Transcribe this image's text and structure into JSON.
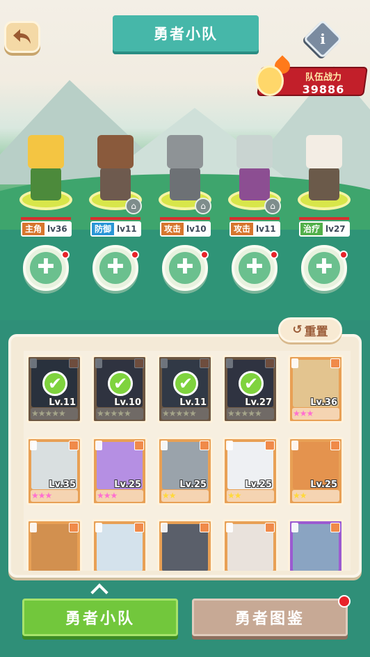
{
  "header": {
    "title": "勇者小队",
    "back_icon": "back-arrow-icon",
    "info_icon": "info-icon",
    "info_glyph": "i"
  },
  "power": {
    "label": "队伍战力",
    "value": "39886",
    "icon": "trophy-fist-icon"
  },
  "party": [
    {
      "role": "主角",
      "level": "lv36",
      "role_color": "#d7762e",
      "locked": false,
      "head_color": "#f4c542",
      "body_color": "#4c8a3b"
    },
    {
      "role": "防御",
      "level": "lv11",
      "role_color": "#2a96d6",
      "locked": true,
      "head_color": "#8a5a3c",
      "body_color": "#6e5a4e"
    },
    {
      "role": "攻击",
      "level": "lv10",
      "role_color": "#d7762e",
      "locked": true,
      "head_color": "#8e9396",
      "body_color": "#6d7175"
    },
    {
      "role": "攻击",
      "level": "lv11",
      "role_color": "#d7762e",
      "locked": true,
      "head_color": "#c9d4d1",
      "body_color": "#8c4e92"
    },
    {
      "role": "治疗",
      "level": "lv27",
      "role_color": "#52b04a",
      "locked": false,
      "head_color": "#f3ede4",
      "body_color": "#6b5a4a"
    }
  ],
  "add_slot_glyph": "✚",
  "lock_glyph": "🔒",
  "reset_label": "重置",
  "reset_icon": "↺",
  "check_glyph": "✔",
  "roster": [
    {
      "level": "Lv.11",
      "stars": "★★★★★",
      "star_color": "grey",
      "in_team": true,
      "frame": "orange",
      "art": "#3b3f48"
    },
    {
      "level": "Lv.10",
      "stars": "★★★★★",
      "star_color": "grey",
      "in_team": true,
      "frame": "orange",
      "art": "#4a4450"
    },
    {
      "level": "Lv.11",
      "stars": "★★★★★",
      "star_color": "grey",
      "in_team": true,
      "frame": "orange",
      "art": "#505560"
    },
    {
      "level": "Lv.27",
      "stars": "★★★★★",
      "star_color": "grey",
      "in_team": true,
      "frame": "orange",
      "art": "#4a4652"
    },
    {
      "level": "Lv.36",
      "stars": "★★★",
      "star_color": "pink",
      "in_team": false,
      "frame": "orange",
      "art": "#e3c48f"
    },
    {
      "level": "Lv.35",
      "stars": "★★★",
      "star_color": "pink",
      "in_team": false,
      "frame": "orange",
      "art": "#d9dfe0"
    },
    {
      "level": "Lv.25",
      "stars": "★★★",
      "star_color": "pink",
      "in_team": false,
      "frame": "orange",
      "art": "#b58fe3"
    },
    {
      "level": "Lv.25",
      "stars": "★★",
      "star_color": "gold",
      "in_team": false,
      "frame": "orange",
      "art": "#9aa3ab"
    },
    {
      "level": "Lv.25",
      "stars": "★★",
      "star_color": "gold",
      "in_team": false,
      "frame": "orange",
      "art": "#eef0f3"
    },
    {
      "level": "Lv.25",
      "stars": "★★",
      "star_color": "gold",
      "in_team": false,
      "frame": "orange",
      "art": "#e4934e"
    },
    {
      "level": "",
      "stars": "",
      "star_color": "gold",
      "in_team": false,
      "frame": "orange",
      "art": "#d2904f"
    },
    {
      "level": "",
      "stars": "",
      "star_color": "gold",
      "in_team": false,
      "frame": "orange",
      "art": "#d4e2ec"
    },
    {
      "level": "",
      "stars": "",
      "star_color": "gold",
      "in_team": false,
      "frame": "orange",
      "art": "#5a5f6a"
    },
    {
      "level": "",
      "stars": "",
      "star_color": "gold",
      "in_team": false,
      "frame": "orange",
      "art": "#e9e2dc"
    },
    {
      "level": "",
      "stars": "",
      "star_color": "gold",
      "in_team": false,
      "frame": "purple",
      "art": "#8aa4c2"
    }
  ],
  "bottom": {
    "chevron_icon": "chevron-up-icon",
    "team_label": "勇者小队",
    "dex_label": "勇者图鉴"
  }
}
